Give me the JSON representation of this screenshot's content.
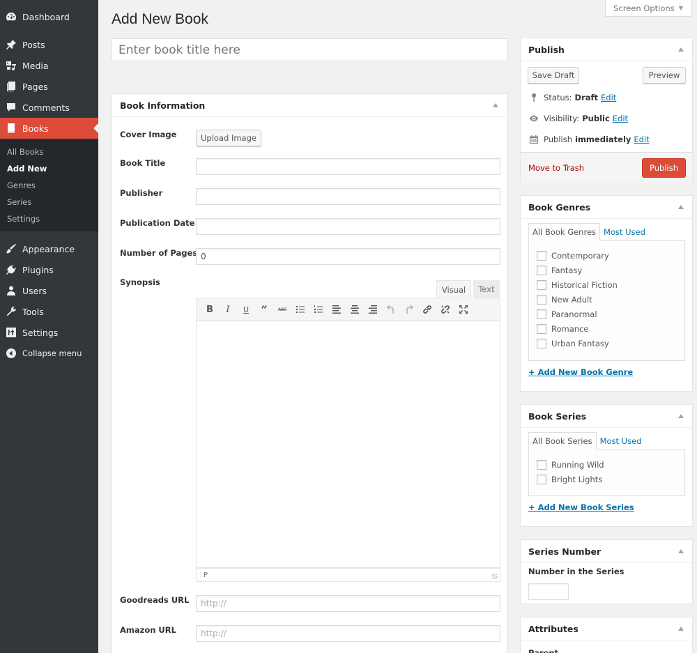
{
  "sidebar": {
    "items": [
      {
        "label": "Dashboard",
        "icon": "dashboard-icon"
      },
      {
        "label": "Posts",
        "icon": "pushpin-icon"
      },
      {
        "label": "Media",
        "icon": "media-icon"
      },
      {
        "label": "Pages",
        "icon": "pages-icon"
      },
      {
        "label": "Comments",
        "icon": "comment-icon"
      },
      {
        "label": "Books",
        "icon": "book-icon",
        "current": true
      },
      {
        "label": "Appearance",
        "icon": "paintbrush-icon"
      },
      {
        "label": "Plugins",
        "icon": "plugin-icon"
      },
      {
        "label": "Users",
        "icon": "user-icon"
      },
      {
        "label": "Tools",
        "icon": "wrench-icon"
      },
      {
        "label": "Settings",
        "icon": "settings-icon"
      }
    ],
    "submenu": [
      {
        "label": "All Books"
      },
      {
        "label": "Add New",
        "current": true
      },
      {
        "label": "Genres"
      },
      {
        "label": "Series"
      },
      {
        "label": "Settings"
      }
    ],
    "collapse_label": "Collapse menu",
    "accent_color": "#dd4b39"
  },
  "header": {
    "title": "Add New Book",
    "screen_options": "Screen Options",
    "title_placeholder": "Enter book title here"
  },
  "book_info": {
    "title": "Book Information",
    "cover_label": "Cover Image",
    "upload_button": "Upload Image",
    "fields": [
      {
        "label": "Book Title",
        "value": "",
        "placeholder": ""
      },
      {
        "label": "Publisher",
        "value": "",
        "placeholder": ""
      },
      {
        "label": "Publication Date",
        "value": "",
        "placeholder": ""
      },
      {
        "label": "Number of Pages",
        "value": "0",
        "placeholder": ""
      }
    ],
    "synopsis_label": "Synopsis",
    "editor": {
      "tab_visual": "Visual",
      "tab_text": "Text",
      "toolbar": [
        "bold",
        "italic",
        "underline",
        "blockquote",
        "strikethrough",
        "bullet-list",
        "numbered-list",
        "align-left",
        "align-center",
        "align-right",
        "undo",
        "redo",
        "link",
        "unlink",
        "fullscreen"
      ],
      "status_path": "P"
    },
    "url_fields": [
      {
        "label": "Goodreads URL",
        "placeholder": "http://"
      },
      {
        "label": "Amazon URL",
        "placeholder": "http://"
      }
    ]
  },
  "publish": {
    "title": "Publish",
    "save_draft": "Save Draft",
    "preview": "Preview",
    "status_label": "Status:",
    "status_value": "Draft",
    "visibility_label": "Visibility:",
    "visibility_value": "Public",
    "schedule_label": "Publish",
    "schedule_value": "immediately",
    "edit": "Edit",
    "trash": "Move to Trash",
    "publish_button": "Publish"
  },
  "genres": {
    "title": "Book Genres",
    "tab_all": "All Book Genres",
    "tab_most_used": "Most Used",
    "items": [
      "Contemporary",
      "Fantasy",
      "Historical Fiction",
      "New Adult",
      "Paranormal",
      "Romance",
      "Urban Fantasy"
    ],
    "add_link": "+ Add New Book Genre"
  },
  "series": {
    "title": "Book Series",
    "tab_all": "All Book Series",
    "tab_most_used": "Most Used",
    "items": [
      "Running Wild",
      "Bright Lights"
    ],
    "add_link": "+ Add New Book Series"
  },
  "series_number": {
    "title": "Series Number",
    "label": "Number in the Series",
    "value": ""
  },
  "attributes": {
    "title": "Attributes",
    "parent_label": "Parent"
  }
}
